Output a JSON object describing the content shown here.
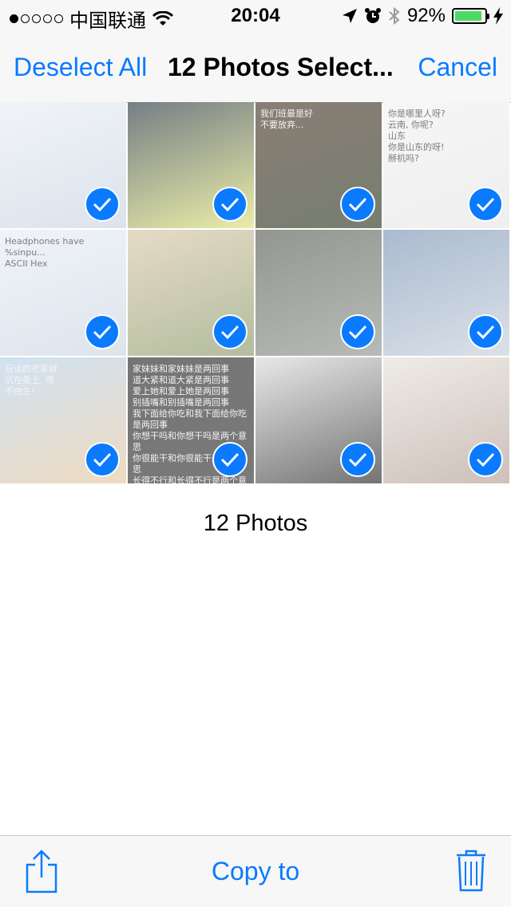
{
  "status_bar": {
    "carrier": "中国联通",
    "time": "20:04",
    "battery_percent": "92%",
    "battery_level": 0.92,
    "signal_bars_filled": 1,
    "icons": [
      "wifi-icon",
      "location-arrow-icon",
      "alarm-icon",
      "bluetooth-icon",
      "charging-bolt-icon"
    ]
  },
  "nav": {
    "deselect_label": "Deselect All",
    "title": "12 Photos Select...",
    "cancel_label": "Cancel"
  },
  "photos": [
    {
      "colors": [
        "#e9eef3",
        "#c9d4e2"
      ],
      "text": ""
    },
    {
      "colors": [
        "#2c3a44",
        "#dfe47a"
      ],
      "text": ""
    },
    {
      "colors": [
        "#4b3a2b",
        "#2e3a25"
      ],
      "text": "我们班最是好\n不要放弃..."
    },
    {
      "colors": [
        "#f2f2f2",
        "#e6e6e6"
      ],
      "text": "你是哪里人呀?\n云南, 你呢?\n山东\n你是山东的呀!\n掰机吗?"
    },
    {
      "colors": [
        "#e8eef5",
        "#ccd6e3"
      ],
      "text": "Headphones have %sinpu...\nASCII   Hex"
    },
    {
      "colors": [
        "#d9c8a8",
        "#8a9a6a"
      ],
      "text": ""
    },
    {
      "colors": [
        "#5a5f55",
        "#8f9791"
      ],
      "text": ""
    },
    {
      "colors": [
        "#7d96b5",
        "#c7d1dc"
      ],
      "text": ""
    },
    {
      "colors": [
        "#b7d2ea",
        "#e6c8a0"
      ],
      "text": "玩谈的老家就\n坑在桑上. 喂\n不由生!"
    },
    {
      "colors": [
        "#2b2b2b",
        "#333333"
      ],
      "text": "家妹妹和家妹妹是两回事\n道大紧和道大紧是两回事\n爱上她和爱上她是两回事\n别插嘴和别插嘴是两回事\n我下面给你吃和我下面给你吃是两回事\n你想干吗和你想干吗是两个意思\n你很能干和你很能干是两个意思\n长得不行和长得不行是两个意思\n日后再说和日后再说是两个意思\n大学生活好和大学生活好是两个意思\n一大波妹子和一大波妹子是两个意思"
    },
    {
      "colors": [
        "#dcdcdc",
        "#2a2a2a"
      ],
      "text": ""
    },
    {
      "colors": [
        "#e7e2dc",
        "#b29f93"
      ],
      "text": ""
    }
  ],
  "footer_count": "12 Photos",
  "toolbar": {
    "copy_label": "Copy to",
    "share_icon": "share-icon",
    "trash_icon": "trash-icon"
  },
  "accent_color": "#0a7aff",
  "check_color": "#0a7aff"
}
